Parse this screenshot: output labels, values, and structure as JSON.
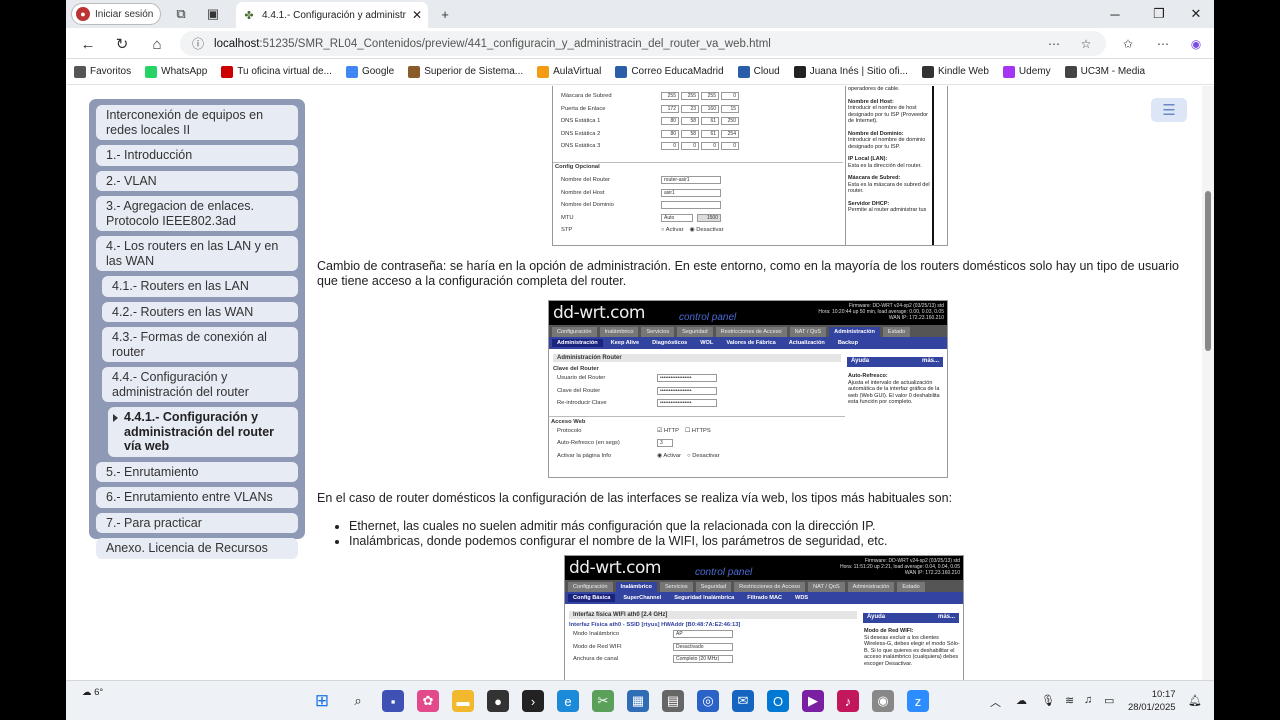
{
  "browser": {
    "profile_label": "Iniciar sesión",
    "tab_title": "4.4.1.- Configuración y administra",
    "url_host": "localhost",
    "url_path": ":51235/SMR_RL04_Contenidos/preview/441_configuracin_y_administracin_del_router_va_web.html"
  },
  "bookmarks": [
    {
      "label": "Favoritos",
      "color": "#555"
    },
    {
      "label": "WhatsApp",
      "color": "#25d366"
    },
    {
      "label": "Tu oficina virtual de...",
      "color": "#c00"
    },
    {
      "label": "Google",
      "color": "#4285f4"
    },
    {
      "label": "Superior de Sistema...",
      "color": "#8b5a2b"
    },
    {
      "label": "AulaVirtual",
      "color": "#f39c12"
    },
    {
      "label": "Correo EducaMadrid",
      "color": "#2a5ea8"
    },
    {
      "label": "Cloud",
      "color": "#2a5ea8"
    },
    {
      "label": "Juana Inés | Sitio ofi...",
      "color": "#222"
    },
    {
      "label": "Kindle Web",
      "color": "#333"
    },
    {
      "label": "Udemy",
      "color": "#a435f0"
    },
    {
      "label": "UC3M - Media",
      "color": "#444"
    }
  ],
  "menu": [
    {
      "label": "Interconexión de equipos en redes locales II",
      "level": 0
    },
    {
      "label": "1.- Introducción",
      "level": 0
    },
    {
      "label": "2.- VLAN",
      "level": 0
    },
    {
      "label": "3.- Agregacion de enlaces. Protocolo IEEE802.3ad",
      "level": 0
    },
    {
      "label": "4.- Los routers en las LAN y en las WAN",
      "level": 0
    },
    {
      "label": "4.1.- Routers en las LAN",
      "level": 1
    },
    {
      "label": "4.2.- Routers en las WAN",
      "level": 1
    },
    {
      "label": "4.3.- Formas de conexión al router",
      "level": 1
    },
    {
      "label": "4.4.- Configuración y administración del router",
      "level": 1
    },
    {
      "label": "4.4.1.- Configuración y administración del router vía web",
      "level": 2
    },
    {
      "label": "5.- Enrutamiento",
      "level": 0
    },
    {
      "label": "6.- Enrutamiento entre VLANs",
      "level": 0
    },
    {
      "label": "7.- Para practicar",
      "level": 0
    },
    {
      "label": "Anexo. Licencia de Recursos",
      "level": 0
    }
  ],
  "content": {
    "para1": "Cambio de contraseña: se haría en la opción de administración. En este entorno, como en la mayoría de los routers domésticos solo hay un tipo de usuario que tiene acceso a la configuración completa del router.",
    "para2": "En el caso de router domésticos la configuración de las interfaces se realiza vía web, los tipos más habituales son:",
    "bullet1": "Ethernet, las cuales no suelen admitir más configuración que la relacionada con la dirección IP.",
    "bullet2": "Inalámbricas, donde podemos configurar el nombre de la WIFI, los parámetros de seguridad, etc."
  },
  "shot1": {
    "rows": [
      {
        "label": "Máscara de Subred",
        "v": [
          "255",
          "255",
          "255",
          "0"
        ]
      },
      {
        "label": "Puerta de Enlace",
        "v": [
          "172",
          "23",
          "160",
          "15"
        ]
      },
      {
        "label": "DNS Estática 1",
        "v": [
          "80",
          "58",
          "61",
          "250"
        ]
      },
      {
        "label": "DNS Estática 2",
        "v": [
          "80",
          "58",
          "61",
          "254"
        ]
      },
      {
        "label": "DNS Estática 3",
        "v": [
          "0",
          "0",
          "0",
          "0"
        ]
      }
    ],
    "opt_title": "Config Opcional",
    "router_name_label": "Nombre del Router",
    "router_name": "router-asir1",
    "host_label": "Nombre del Host",
    "host": "asir1",
    "domain_label": "Nombre del Dominio",
    "mtu_label": "MTU",
    "mtu_mode": "Auto",
    "mtu_value": "1500",
    "stp_label": "STP",
    "stp_on": "Activar",
    "stp_off": "Desactivar",
    "help": [
      {
        "t": "",
        "d": "operadores de cable."
      },
      {
        "t": "Nombre del Host:",
        "d": "Introducir el nombre de host designado por tu ISP (Proveedor de Internet)."
      },
      {
        "t": "Nombre del Dominio:",
        "d": "Introducir el nombre de dominio designado por tu ISP."
      },
      {
        "t": "IP Local (LAN):",
        "d": "Esta es la dirección del router."
      },
      {
        "t": "Máscara de Subred:",
        "d": "Esta es la máscara de subred del router."
      },
      {
        "t": "Servidor DHCP:",
        "d": "Permite al router administrar tus"
      }
    ]
  },
  "shot2": {
    "logo": "dd-wrt.com",
    "cp": "control panel",
    "info": [
      "Firmware: DD-WRT v24-sp2 (03/25/13) std",
      "Hora: 10:20:44 up 50 min, load average: 0.00, 0.03, 0.05",
      "WAN IP: 172.23.160.210"
    ],
    "tabs": [
      "Configuración",
      "Inalámbrico",
      "Servicios",
      "Seguridad",
      "Restricciones de Acceso",
      "NAT / QoS",
      "Administración",
      "Estado"
    ],
    "subtabs": [
      "Administración",
      "Keep Alive",
      "Diagnósticos",
      "WOL",
      "Valores de Fábrica",
      "Actualización",
      "Backup"
    ],
    "title": "Administración Router",
    "clave_title": "Clave del Router",
    "user_label": "Usuario del Router",
    "pass_label": "Clave del Router",
    "repass_label": "Re-introducir Clave",
    "masked": "••••••••••••••••••",
    "web_title": "Acceso Web",
    "proto_label": "Protocolo",
    "http": "HTTP",
    "https": "HTTPS",
    "refresh_label": "Auto-Refresco (en segs)",
    "refresh": "3",
    "info_label": "Activar la página Info",
    "on": "Activar",
    "off": "Desactivar",
    "help_title": "Ayuda",
    "help_more": "más...",
    "help_h": "Auto-Refresco:",
    "help_d": "Ajusta el intervalo de actualización automática de la interfaz gráfica de la web (Web GUI). El valor 0 deshabilita esta función por completo."
  },
  "shot3": {
    "info": [
      "Firmware: DD-WRT v24-sp2 (03/25/13) std",
      "Hora: 11:51:20 up 2:21, load average: 0.04, 0.04, 0.05",
      "WAN IP: 172.23.160.210"
    ],
    "tabs": [
      "Configuración",
      "Inalámbrico",
      "Servicios",
      "Seguridad",
      "Restricciones de Acceso",
      "NAT / QoS",
      "Administración",
      "Estado"
    ],
    "subtabs": [
      "Config Básica",
      "SuperChannel",
      "Seguridad Inalámbrica",
      "Filtrado MAC",
      "WDS"
    ],
    "title": "Interfaz física WIFI ath0 [2.4 GHz]",
    "iface": "Interfaz Física ath0 - SSID [rtyus] HWAddr [B0:48:7A:E2:46:13]",
    "rows": [
      {
        "label": "Modo Inalámbrico",
        "v": "AP"
      },
      {
        "label": "Modo de Red WIFI",
        "v": "Desactivado"
      },
      {
        "label": "Anchura de canal",
        "v": "Completo (20 MHz)"
      }
    ],
    "help_title": "Ayuda",
    "help_more": "más...",
    "help_h": "Modo de Red WIFI:",
    "help_d": "Si deseas excluir a los clientes Wireless-G, debes elegir el modo Sólo-B. Si lo que quieres es deshabilitar el acceso inalámbrico (cualquiera) debes escoger Desactivar."
  },
  "taskbar": {
    "temp": "6°",
    "time": "10:17",
    "date": "28/01/2025"
  }
}
